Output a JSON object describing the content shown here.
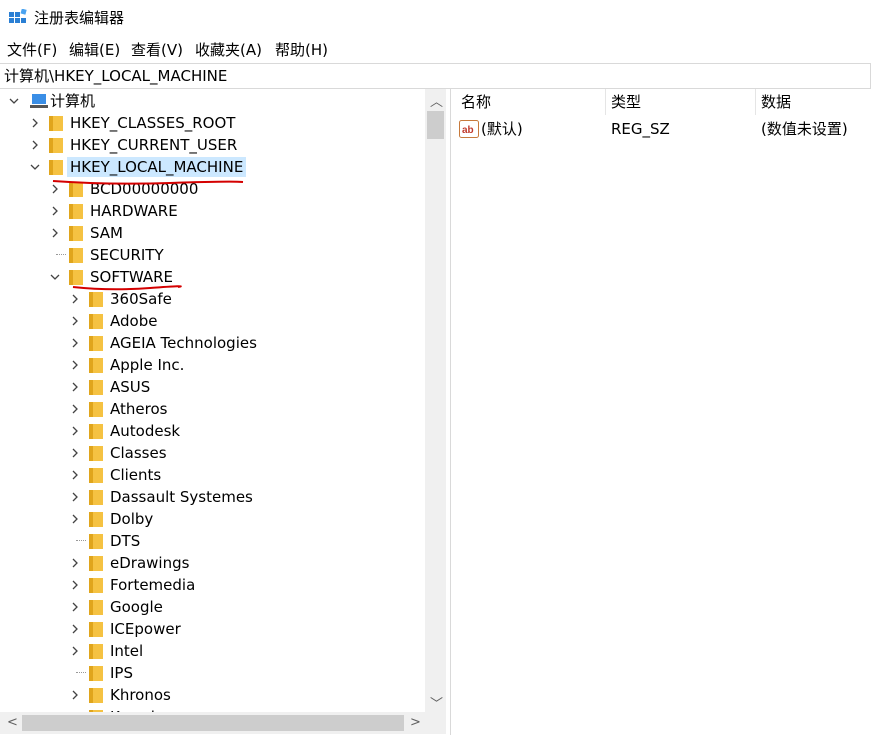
{
  "window": {
    "title": "注册表编辑器"
  },
  "menu": [
    "文件(F)",
    "编辑(E)",
    "查看(V)",
    "收藏夹(A)",
    "帮助(H)"
  ],
  "address": "计算机\\HKEY_LOCAL_MACHINE",
  "tree": {
    "root": "计算机",
    "hives": [
      "HKEY_CLASSES_ROOT",
      "HKEY_CURRENT_USER",
      "HKEY_LOCAL_MACHINE"
    ],
    "hklm_children": [
      "BCD00000000",
      "HARDWARE",
      "SAM",
      "SECURITY",
      "SOFTWARE"
    ],
    "software_children": [
      "360Safe",
      "Adobe",
      "AGEIA Technologies",
      "Apple Inc.",
      "ASUS",
      "Atheros",
      "Autodesk",
      "Classes",
      "Clients",
      "Dassault Systemes",
      "Dolby",
      "DTS",
      "eDrawings",
      "Fortemedia",
      "Google",
      "ICEpower",
      "Intel",
      "IPS",
      "Khronos",
      "Knowles"
    ]
  },
  "list": {
    "headers": [
      "名称",
      "类型",
      "数据"
    ],
    "rows": [
      {
        "name": "(默认)",
        "type": "REG_SZ",
        "data": "(数值未设置)"
      }
    ]
  },
  "colors": {
    "selection": "#cce8ff",
    "folder": "#f5c242",
    "annotation": "#d40000"
  }
}
